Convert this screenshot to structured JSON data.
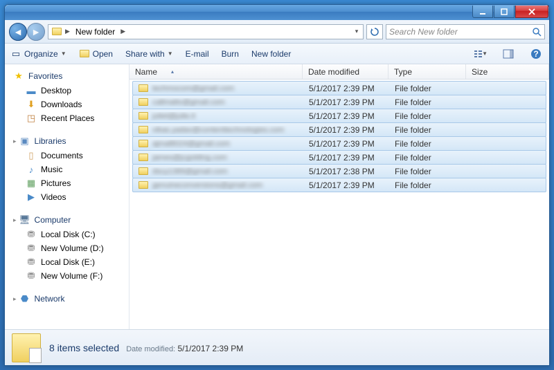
{
  "breadcrumb": {
    "current": "New folder"
  },
  "search": {
    "placeholder": "Search New folder"
  },
  "toolbar": {
    "organize": "Organize",
    "open": "Open",
    "share": "Share with",
    "email": "E-mail",
    "burn": "Burn",
    "newfolder": "New folder"
  },
  "sidebar": {
    "favorites": {
      "label": "Favorites",
      "items": [
        "Desktop",
        "Downloads",
        "Recent Places"
      ]
    },
    "libraries": {
      "label": "Libraries",
      "items": [
        "Documents",
        "Music",
        "Pictures",
        "Videos"
      ]
    },
    "computer": {
      "label": "Computer",
      "items": [
        "Local Disk (C:)",
        "New Volume (D:)",
        "Local Disk (E:)",
        "New Volume (F:)"
      ]
    },
    "network": {
      "label": "Network"
    }
  },
  "columns": {
    "name": "Name",
    "date": "Date modified",
    "type": "Type",
    "size": "Size"
  },
  "rows": [
    {
      "name": "techmocom@gmail.com",
      "date": "5/1/2017 2:39 PM",
      "type": "File folder"
    },
    {
      "name": "callmattv@gmail.com",
      "date": "5/1/2017 2:39 PM",
      "type": "File folder"
    },
    {
      "name": "juliet@julie.it",
      "date": "5/1/2017 2:39 PM",
      "type": "File folder"
    },
    {
      "name": "vikas.yadav@contenttechnologies.com",
      "date": "5/1/2017 2:39 PM",
      "type": "File folder"
    },
    {
      "name": "ajmal8024@gmail.com",
      "date": "5/1/2017 2:39 PM",
      "type": "File folder"
    },
    {
      "name": "james@jcgolding.com",
      "date": "5/1/2017 2:39 PM",
      "type": "File folder"
    },
    {
      "name": "dscy1389@gmail.com",
      "date": "5/1/2017 2:38 PM",
      "type": "File folder"
    },
    {
      "name": "genuineconversions@gmail.com",
      "date": "5/1/2017 2:39 PM",
      "type": "File folder"
    }
  ],
  "details": {
    "title": "8 items selected",
    "meta_label": "Date modified:",
    "meta_value": "5/1/2017 2:39 PM"
  }
}
